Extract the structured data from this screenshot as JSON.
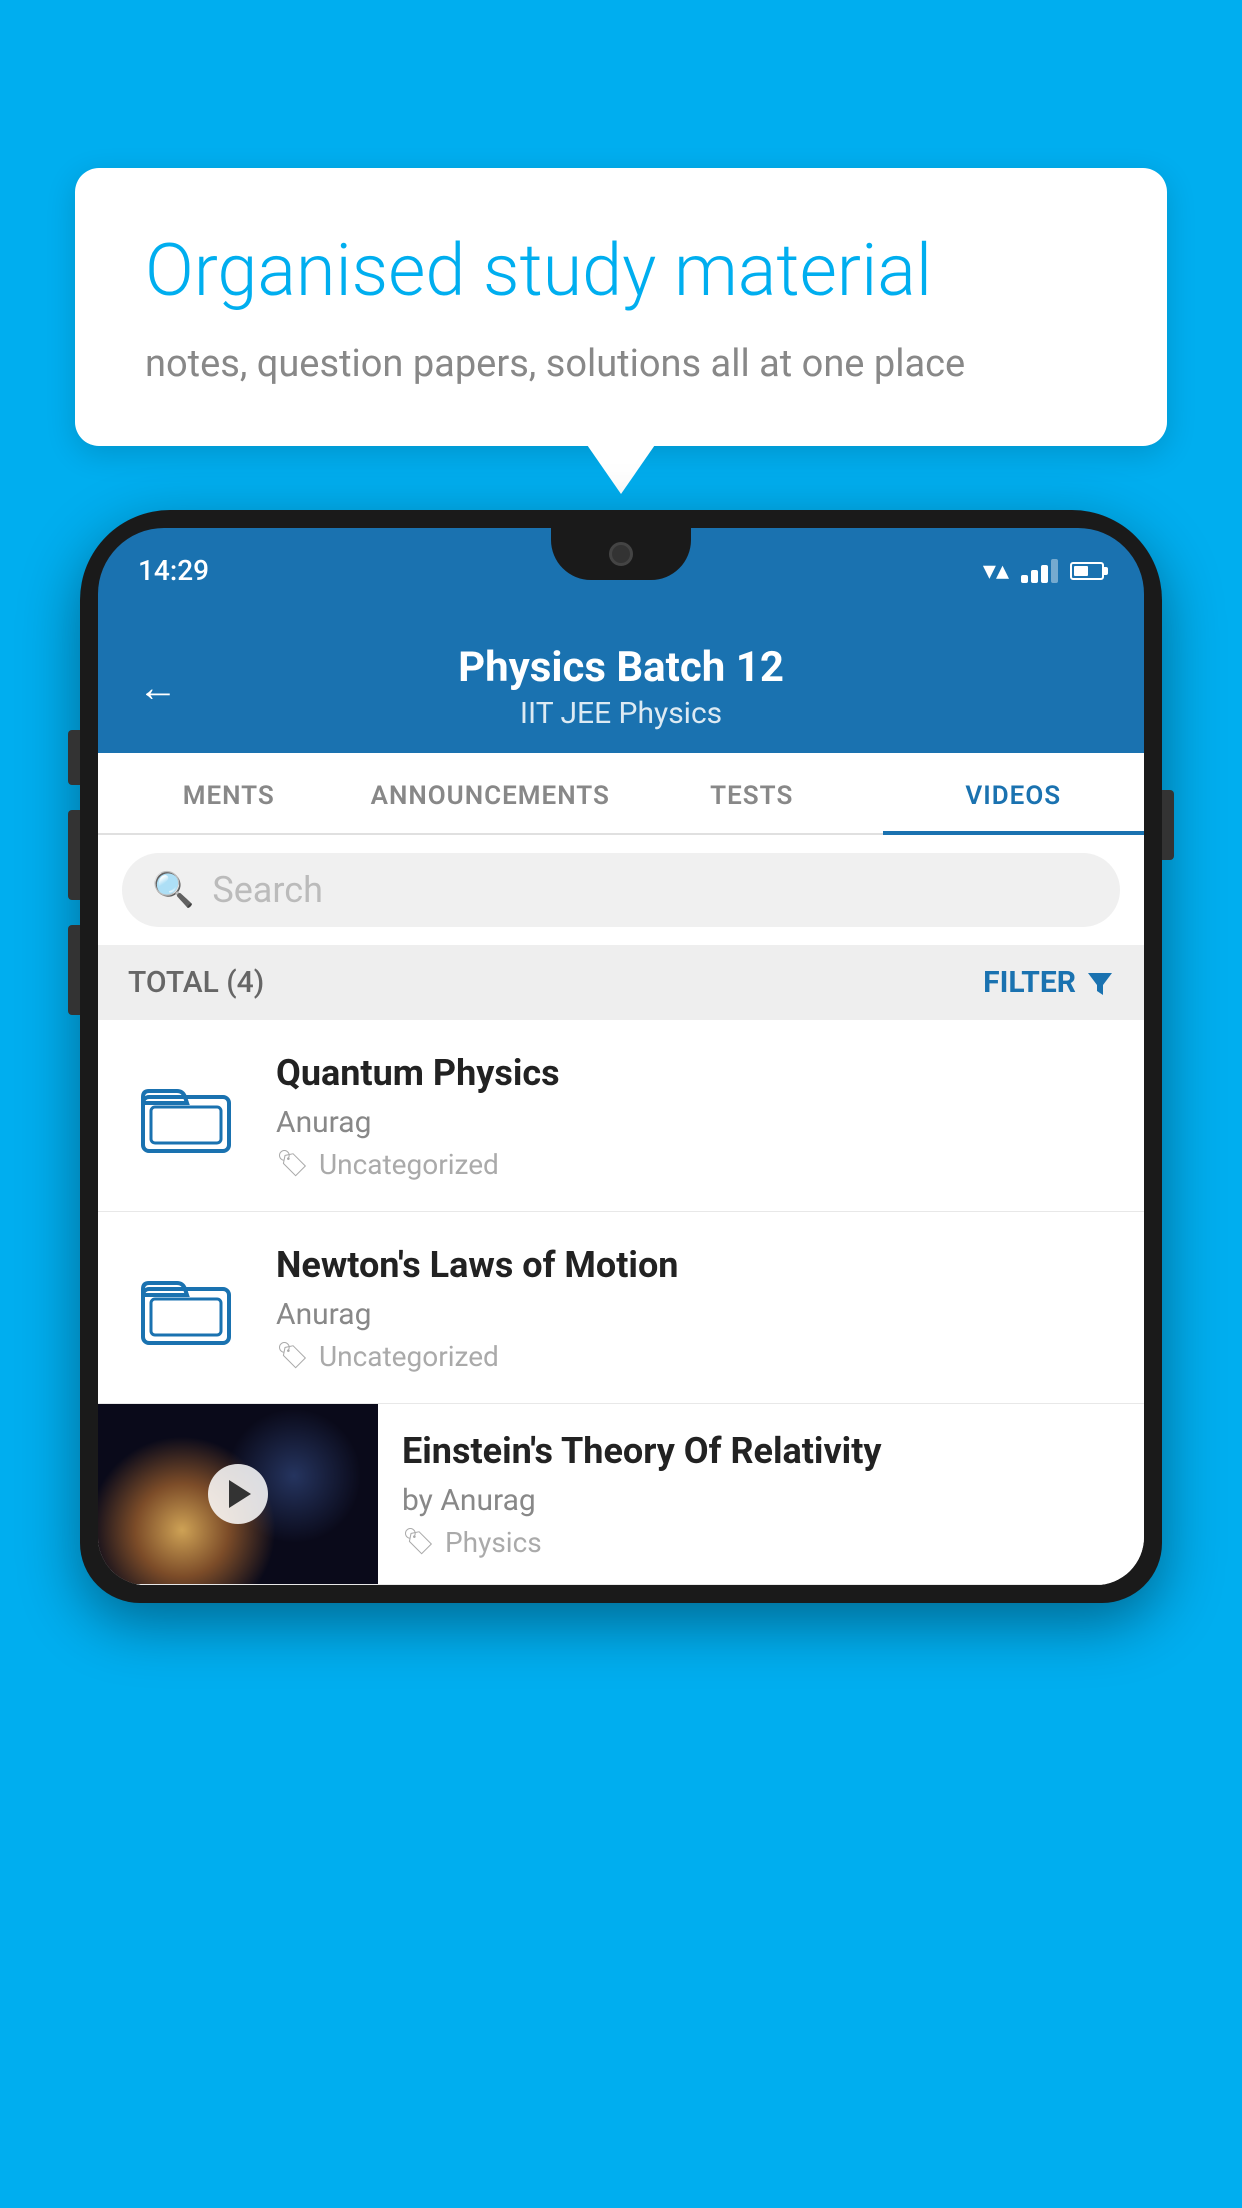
{
  "background_color": "#00AEEF",
  "bubble": {
    "title": "Organised study material",
    "subtitle": "notes, question papers, solutions all at one place"
  },
  "status_bar": {
    "time": "14:29"
  },
  "app_header": {
    "title": "Physics Batch 12",
    "subtitle": "IIT JEE   Physics",
    "back_label": "←"
  },
  "tabs": [
    {
      "label": "MENTS",
      "active": false
    },
    {
      "label": "ANNOUNCEMENTS",
      "active": false
    },
    {
      "label": "TESTS",
      "active": false
    },
    {
      "label": "VIDEOS",
      "active": true
    }
  ],
  "search": {
    "placeholder": "Search"
  },
  "filter_bar": {
    "total_label": "TOTAL (4)",
    "filter_label": "FILTER"
  },
  "videos": [
    {
      "id": 1,
      "title": "Quantum Physics",
      "author": "Anurag",
      "tag": "Uncategorized",
      "has_thumbnail": false
    },
    {
      "id": 2,
      "title": "Newton's Laws of Motion",
      "author": "Anurag",
      "tag": "Uncategorized",
      "has_thumbnail": false
    },
    {
      "id": 3,
      "title": "Einstein's Theory Of Relativity",
      "author": "by Anurag",
      "tag": "Physics",
      "has_thumbnail": true
    }
  ]
}
